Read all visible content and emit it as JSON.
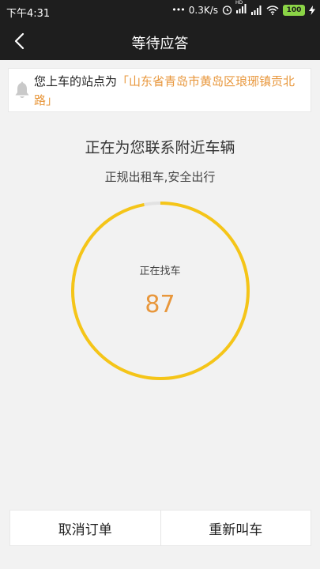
{
  "status_bar": {
    "time": "下午4:31",
    "network_speed": "0.3K/s",
    "network_type": "HD",
    "battery": "100",
    "icons": [
      "dots-icon",
      "alarm-icon",
      "signal-icon",
      "signal-icon",
      "wifi-icon",
      "battery-icon",
      "charging-icon"
    ]
  },
  "header": {
    "title": "等待应答",
    "back_icon": "chevron-left-icon"
  },
  "notice": {
    "icon": "bell-icon",
    "prefix": "您上车的站点为",
    "address": "「山东省青岛市黄岛区琅琊镇贡北路」"
  },
  "main": {
    "headline": "正在为您联系附近车辆",
    "subhead": "正规出租车,安全出行",
    "ring_label": "正在找车",
    "countdown": "87",
    "progress_fraction": 0.97
  },
  "actions": {
    "cancel_label": "取消订单",
    "recall_label": "重新叫车"
  },
  "colors": {
    "accent_yellow": "#f5c518",
    "orange_text": "#e8973c",
    "dark_bar": "#1e1e1e",
    "background": "#f2f2f2"
  }
}
